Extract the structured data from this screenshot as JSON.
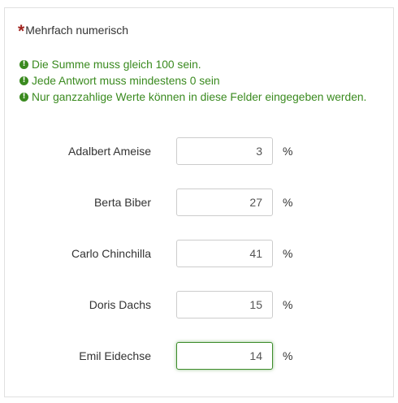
{
  "question": {
    "asterisk": "*",
    "title": "Mehrfach numerisch"
  },
  "tips": [
    {
      "icon": "exclamation-circle-icon",
      "text": "Die Summe muss gleich 100 sein."
    },
    {
      "icon": "exclamation-circle-icon",
      "text": "Jede Antwort muss mindestens 0 sein"
    },
    {
      "icon": "exclamation-circle-icon",
      "text": "Nur ganzzahlige Werte können in diese Felder eingegeben werden."
    }
  ],
  "rows": [
    {
      "label": "Adalbert Ameise",
      "value": "3",
      "suffix": "%"
    },
    {
      "label": "Berta Biber",
      "value": "27",
      "suffix": "%"
    },
    {
      "label": "Carlo Chinchilla",
      "value": "41",
      "suffix": "%"
    },
    {
      "label": "Doris Dachs",
      "value": "15",
      "suffix": "%"
    },
    {
      "label": "Emil Eidechse",
      "value": "14",
      "suffix": "%",
      "focused": true
    }
  ],
  "colors": {
    "tip": "#3a8a1f",
    "asterisk": "#a1241f",
    "focus_border": "#3c8c2a"
  }
}
